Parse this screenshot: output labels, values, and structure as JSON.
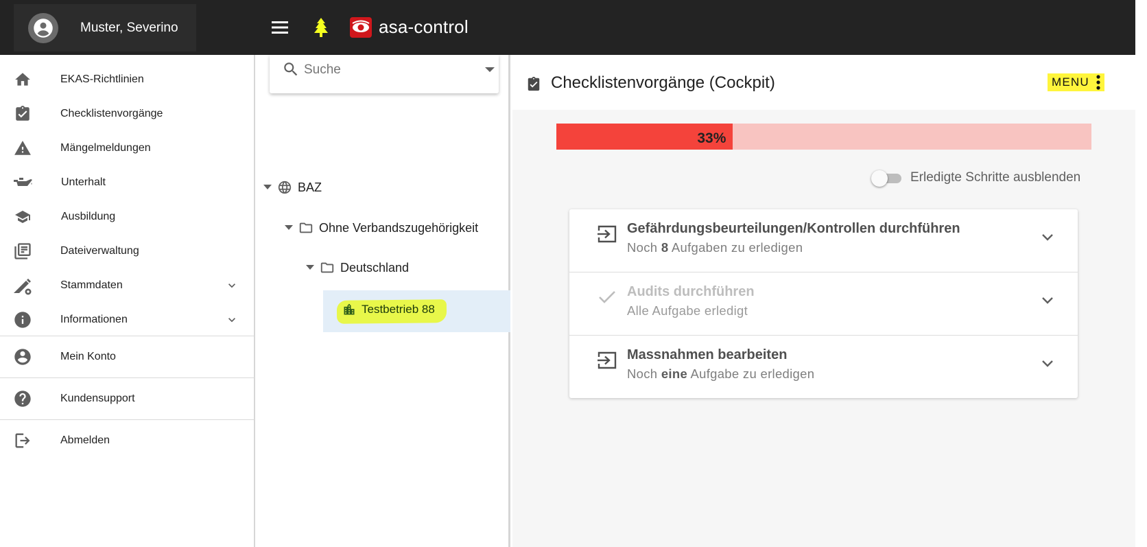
{
  "topbar": {
    "user_name": "Muster, Severino",
    "app_name": "asa-control",
    "icons": [
      "account-circle-icon",
      "menu-icon",
      "tree-icon",
      "asa-logo-icon"
    ]
  },
  "sidebar": {
    "items": [
      {
        "label": "EKAS-Richtlinien",
        "icon": "home-icon"
      },
      {
        "label": "Checklistenvorgänge",
        "icon": "clipboard-check-icon"
      },
      {
        "label": "Mängelmeldungen",
        "icon": "warning-icon"
      },
      {
        "label": "Unterhalt",
        "icon": "oil-can-icon"
      },
      {
        "label": "Ausbildung",
        "icon": "graduation-cap-icon"
      },
      {
        "label": "Dateiverwaltung",
        "icon": "library-books-icon"
      },
      {
        "label": "Stammdaten",
        "icon": "edit-settings-icon",
        "expandable": true
      },
      {
        "label": "Informationen",
        "icon": "info-icon",
        "expandable": true
      },
      {
        "label": "Mein Konto",
        "icon": "account-circle-icon"
      },
      {
        "label": "Kundensupport",
        "icon": "help-icon"
      },
      {
        "label": "Abmelden",
        "icon": "logout-icon"
      }
    ]
  },
  "tree_panel": {
    "search": {
      "placeholder": "Suche",
      "value": ""
    },
    "nodes": [
      {
        "label": "BAZ",
        "icon": "globe-icon",
        "level": 0,
        "expanded": true
      },
      {
        "label": "Ohne Verbandszugehörigkeit",
        "icon": "folder-icon",
        "level": 1,
        "expanded": true
      },
      {
        "label": "Deutschland",
        "icon": "folder-icon",
        "level": 2,
        "expanded": true
      },
      {
        "label": "Testbetrieb 88",
        "icon": "building-icon",
        "level": 3,
        "selected": true
      }
    ]
  },
  "main": {
    "title": "Checklistenvorgänge (Cockpit)",
    "menu_label": "MENU",
    "progress": {
      "percent": 33,
      "label": "33%"
    },
    "toggle": {
      "label": "Erledigte Schritte ausblenden",
      "checked": false
    },
    "steps": [
      {
        "title": "Gefährdungsbeurteilungen/Kontrollen durchführen",
        "sub_pre": "Noch ",
        "sub_bold": "8",
        "sub_post": " Aufgaben zu erledigen",
        "icon": "login-arrow-icon",
        "done": false
      },
      {
        "title": "Audits durchführen",
        "sub_pre": "Alle Aufgabe erledigt",
        "sub_bold": "",
        "sub_post": "",
        "icon": "check-icon",
        "done": true
      },
      {
        "title": "Massnahmen bearbeiten",
        "sub_pre": "Noch ",
        "sub_bold": "eine",
        "sub_post": " Aufgabe zu erledigen",
        "icon": "login-arrow-icon",
        "done": false
      }
    ]
  },
  "colors": {
    "topbar": "#232323",
    "progress_fill": "#f4433b",
    "progress_track": "#f8c4c1",
    "highlight": "#fff53c",
    "selected_row": "#e3eef8"
  }
}
